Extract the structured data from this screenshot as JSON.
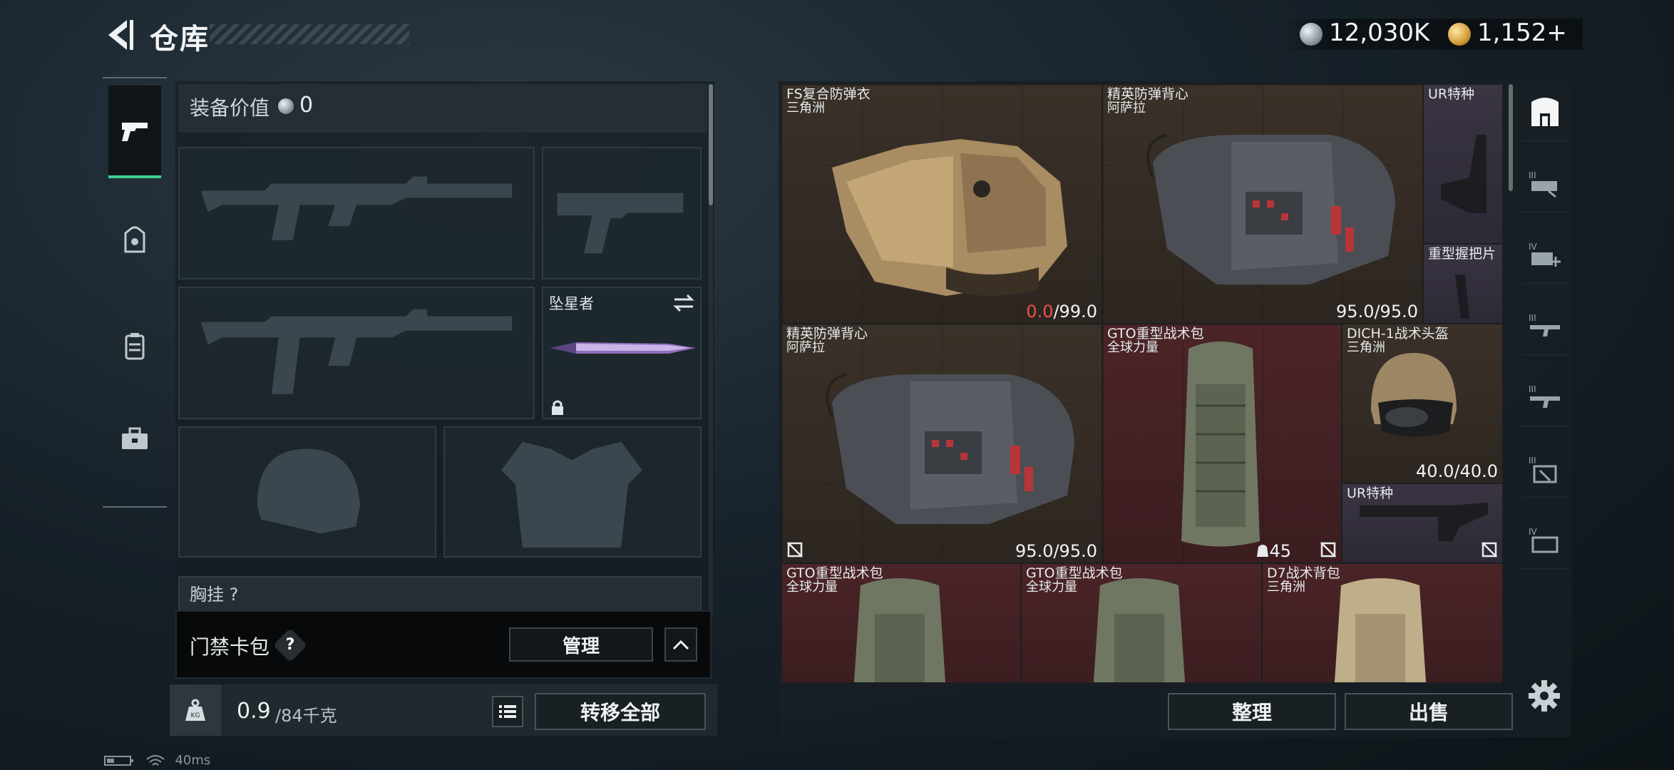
{
  "header": {
    "title": "仓库",
    "back_icon": "back-arrow-icon",
    "currency": [
      {
        "icon": "silver-coin-icon",
        "value": "12,030K"
      },
      {
        "icon": "gold-coin-icon",
        "value": "1,152+"
      }
    ]
  },
  "nav": {
    "tabs": [
      {
        "icon": "pistol-icon",
        "active": true
      },
      {
        "icon": "backpack-icon",
        "active": false
      },
      {
        "icon": "container-icon",
        "active": false
      },
      {
        "icon": "toolbox-icon",
        "active": false
      }
    ]
  },
  "equipment": {
    "value_label": "装备价值",
    "value": "0",
    "melee_slot_label": "坠星者",
    "cut_label": "胸挂 ?"
  },
  "keycard": {
    "label": "门禁卡包",
    "help": "?",
    "manage_label": "管理"
  },
  "weight": {
    "current": "0.9",
    "capacity": "/84千克",
    "transfer_label": "转移全部"
  },
  "status": {
    "ping": "40ms"
  },
  "inventory": {
    "items": [
      {
        "name": "FS复合防弹衣",
        "sub": "三角洲",
        "dura_cur": "0.0",
        "dura_max": "/99.0"
      },
      {
        "name": "精英防弹背心",
        "sub": "阿萨拉",
        "dura": "95.0/95.0"
      },
      {
        "name": "UR特种",
        "sub": ""
      },
      {
        "name": "重型握把片",
        "sub": ""
      },
      {
        "name": "精英防弹背心",
        "sub": "阿萨拉",
        "dura": "95.0/95.0"
      },
      {
        "name": "GTO重型战术包",
        "sub": "全球力量",
        "count": "45"
      },
      {
        "name": "DICH-1战术头盔",
        "sub": "三角洲",
        "dura": "40.0/40.0"
      },
      {
        "name": "UR特种",
        "sub": ""
      },
      {
        "name": "GTO重型战术包",
        "sub": "全球力量"
      },
      {
        "name": "GTO重型战术包",
        "sub": "全球力量"
      },
      {
        "name": "D7战术背包",
        "sub": "三角洲"
      }
    ],
    "sort_label": "整理",
    "sell_label": "出售"
  },
  "rail": {
    "filters": [
      {
        "icon": "all-items-icon",
        "tier": ""
      },
      {
        "icon": "gun-attachment-icon",
        "tier": "III"
      },
      {
        "icon": "medical-icon",
        "tier": "IV"
      },
      {
        "icon": "rifle-icon",
        "tier": "III"
      },
      {
        "icon": "rifle-icon",
        "tier": "III"
      },
      {
        "icon": "armor-icon",
        "tier": "III"
      },
      {
        "icon": "ammo-icon",
        "tier": "IV"
      }
    ]
  },
  "colors": {
    "accent": "#3fcf93",
    "broken": "#e5534a",
    "rarity_brown": "#3a3129",
    "rarity_red": "#4b2427",
    "rarity_purple": "#3a3443"
  }
}
